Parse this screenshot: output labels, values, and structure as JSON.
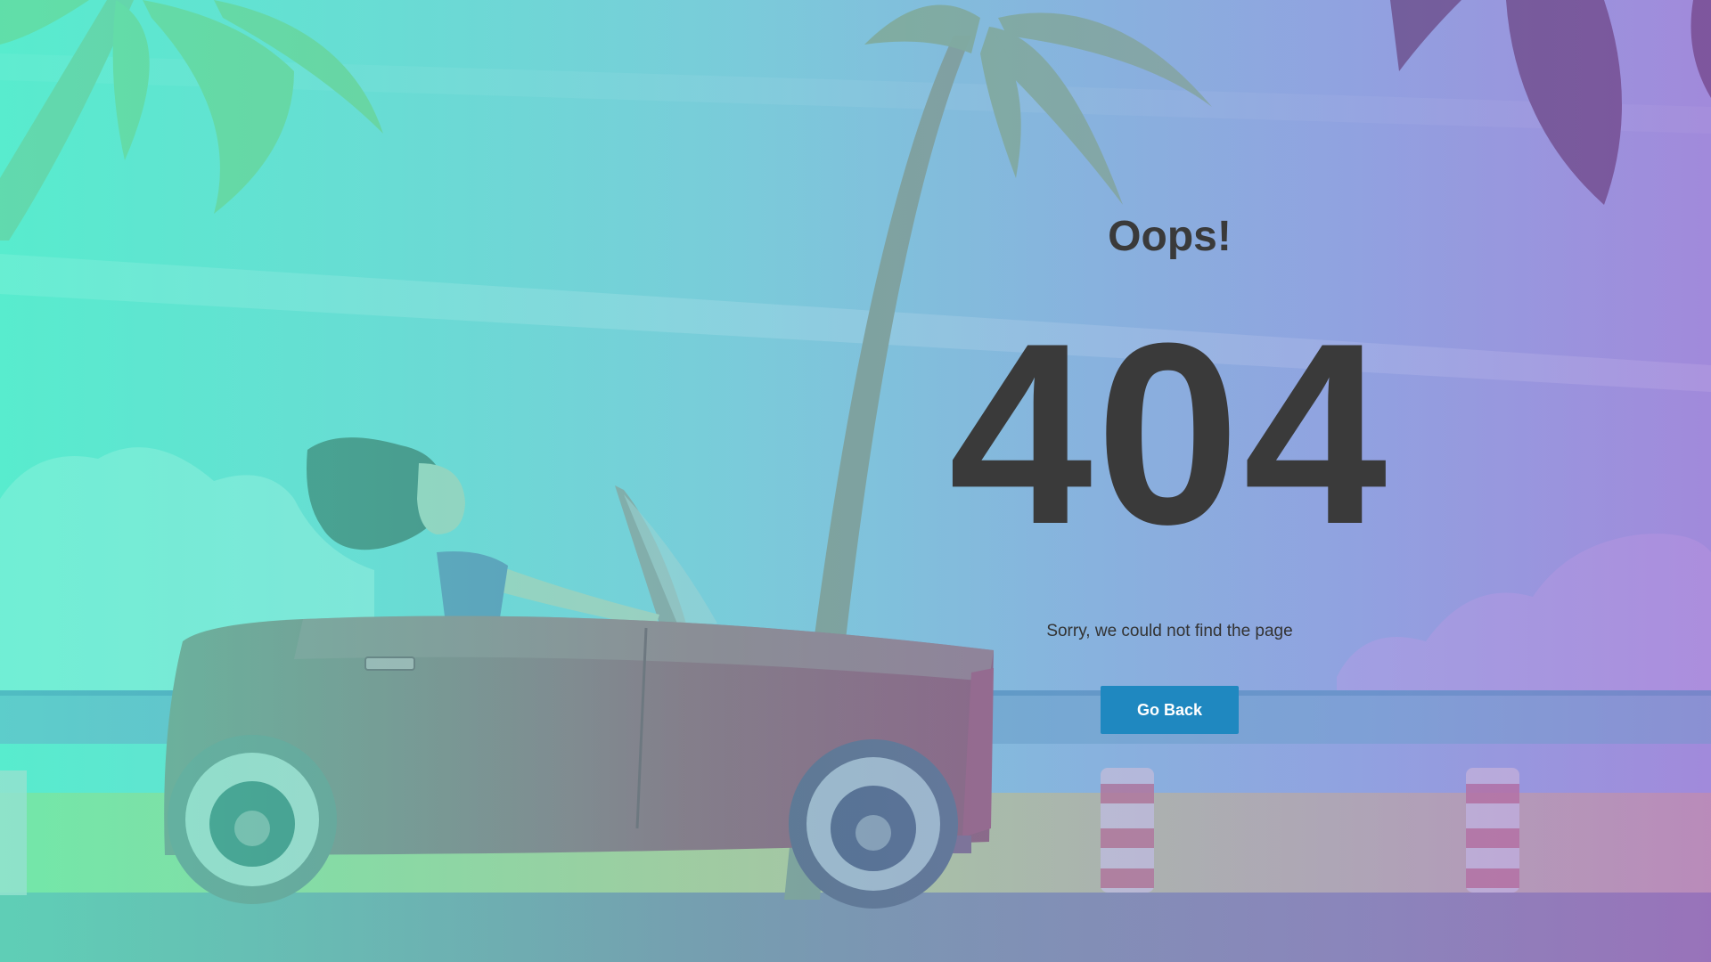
{
  "error": {
    "heading": "Oops!",
    "code": "404",
    "message": "Sorry, we could not find the page",
    "button_label": "Go Back"
  },
  "colors": {
    "text": "#3a3a3a",
    "button": "#1f88c0",
    "button_text": "#ffffff"
  }
}
